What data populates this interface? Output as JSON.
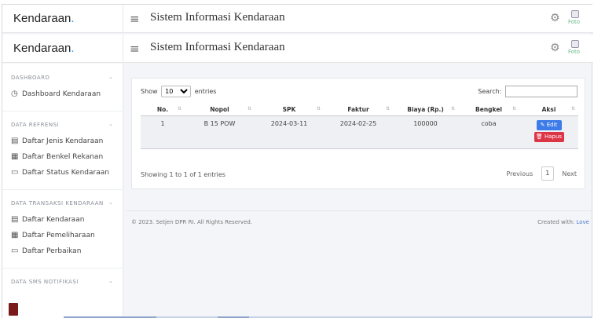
{
  "header": {
    "brand": "Kendaraan",
    "brand_dot": ".",
    "title": "Sistem Informasi Kendaraan",
    "menu_icon": "≡",
    "settings_icon": "⚙",
    "avatar_text": "Foto"
  },
  "sidebar": {
    "sections": [
      {
        "title": "DASHBOARD",
        "items": [
          {
            "icon": "clock-icon",
            "glyph": "◷",
            "label": "Dashboard Kendaraan"
          }
        ]
      },
      {
        "title": "DATA REFRENSI",
        "items": [
          {
            "icon": "book-icon",
            "glyph": "▤",
            "label": "Daftar Jenis Kendaraan"
          },
          {
            "icon": "calendar-icon",
            "glyph": "▦",
            "label": "Daftar Benkel Rekanan"
          },
          {
            "icon": "monitor-icon",
            "glyph": "▭",
            "label": "Daftar Status Kendaraan"
          }
        ]
      },
      {
        "title": "DATA TRANSAKSI KENDARAAN",
        "items": [
          {
            "icon": "book-icon",
            "glyph": "▤",
            "label": "Daftar Kendaraan"
          },
          {
            "icon": "calendar-icon",
            "glyph": "▦",
            "label": "Daftar Pemeliharaan"
          },
          {
            "icon": "monitor-icon",
            "glyph": "▭",
            "label": "Daftar Perbaikan"
          }
        ]
      },
      {
        "title": "DATA SMS NOTIFIKASI",
        "items": []
      }
    ],
    "chevron": "⌄"
  },
  "table": {
    "show_label": "Show",
    "entries_value": "10",
    "entries_label": "entries",
    "search_label": "Search:",
    "search_value": "",
    "columns": [
      "No.",
      "Nopol",
      "SPK",
      "Faktur",
      "Biaya (Rp.)",
      "Bengkel",
      "Aksi"
    ],
    "rows": [
      {
        "no": "1",
        "nopol": "B 15 POW",
        "spk": "2024-03-11",
        "faktur": "2024-02-25",
        "biaya": "100000",
        "bengkel": "coba",
        "edit": "✎ Edit",
        "hapus": "🗑 Hapus"
      }
    ],
    "info": "Showing 1 to 1 of 1 entries",
    "pager": {
      "previous": "Previous",
      "page": "1",
      "next": "Next"
    }
  },
  "footer": {
    "copyright": "© 2023. Setjen DPR RI. All Rights Reserved.",
    "created_label": "Created with:",
    "created_link": "Love"
  },
  "colors": {
    "accent": "#3d7be8",
    "danger": "#dc3545",
    "brand_dot": "#00a3ff"
  }
}
